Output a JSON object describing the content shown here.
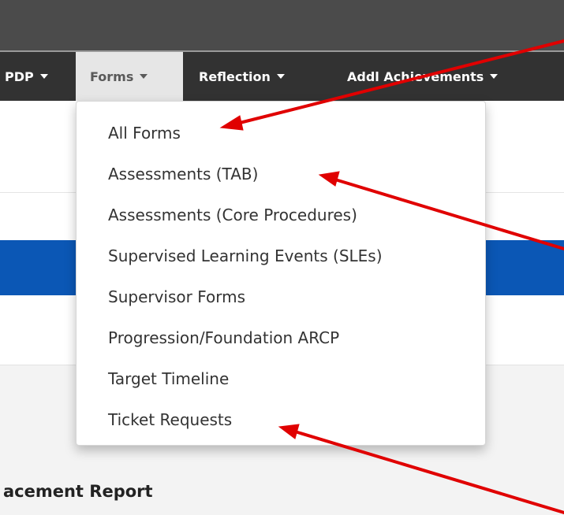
{
  "navbar": {
    "items": [
      {
        "label": "PDP"
      },
      {
        "label": "Forms"
      },
      {
        "label": "Reflection"
      },
      {
        "label": "Addl Achievements"
      }
    ]
  },
  "forms_menu": {
    "items": [
      {
        "label": "All Forms"
      },
      {
        "label": "Assessments (TAB)"
      },
      {
        "label": "Assessments (Core Procedures)"
      },
      {
        "label": "Supervised Learning Events (SLEs)"
      },
      {
        "label": "Supervisor Forms"
      },
      {
        "label": "Progression/Foundation ARCP"
      },
      {
        "label": "Target Timeline"
      },
      {
        "label": "Ticket Requests"
      }
    ]
  },
  "page": {
    "section_title": "acement Report"
  },
  "colors": {
    "top_bar": "#4b4b4b",
    "navbar": "#323232",
    "active_tab": "#e6e6e6",
    "blue_band": "#0b57b5",
    "annotation_arrow": "#e00000"
  },
  "icons": [
    "caret-down-icon",
    "annotation-arrow"
  ]
}
